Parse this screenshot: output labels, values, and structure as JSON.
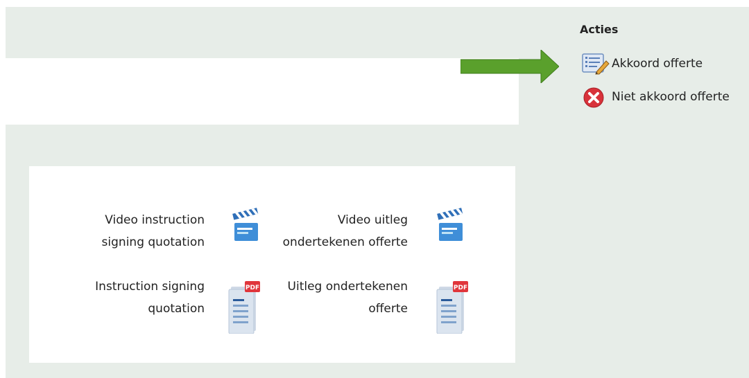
{
  "actions": {
    "title": "Acties",
    "items": [
      {
        "label": "Akkoord offerte",
        "icon": "document-edit-icon"
      },
      {
        "label": "Niet akkoord offerte",
        "icon": "reject-icon"
      }
    ]
  },
  "resources": [
    {
      "lines": [
        "Video instruction",
        "signing quotation"
      ],
      "icon": "clapperboard-icon"
    },
    {
      "lines": [
        "Video uitleg",
        "ondertekenen offerte"
      ],
      "icon": "clapperboard-icon"
    },
    {
      "lines": [
        "Instruction signing",
        "quotation"
      ],
      "icon": "pdf-document-icon"
    },
    {
      "lines": [
        "Uitleg ondertekenen",
        "offerte"
      ],
      "icon": "pdf-document-icon"
    }
  ],
  "colors": {
    "background": "#e7ede8",
    "arrow": "#5aa02c",
    "reject": "#d8323a",
    "video_icon": "#3f8ed8",
    "pdf_badge": "#e0363c"
  }
}
